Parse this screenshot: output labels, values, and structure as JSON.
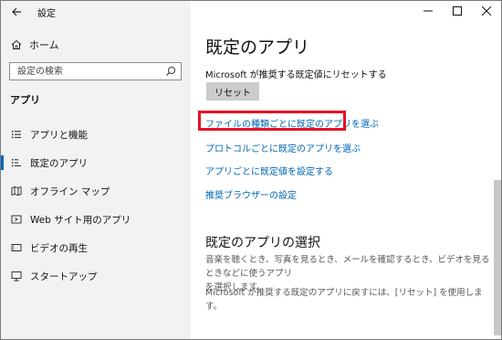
{
  "window": {
    "title": "設定"
  },
  "sidebar": {
    "home_label": "ホーム",
    "search_placeholder": "設定の検索",
    "section_label": "アプリ",
    "items": [
      {
        "label": "アプリと機能",
        "icon": "list-icon"
      },
      {
        "label": "既定のアプリ",
        "icon": "default-apps-icon",
        "selected": true
      },
      {
        "label": "オフライン マップ",
        "icon": "map-icon"
      },
      {
        "label": "Web サイト用のアプリ",
        "icon": "web-apps-icon"
      },
      {
        "label": "ビデオの再生",
        "icon": "video-icon"
      },
      {
        "label": "スタートアップ",
        "icon": "startup-icon"
      }
    ]
  },
  "main": {
    "title": "既定のアプリ",
    "reset_description": "Microsoft が推奨する既定値にリセットする",
    "reset_button": "リセット",
    "links": [
      "ファイルの種類ごとに既定のアプリを選ぶ",
      "プロトコルごとに既定のアプリを選ぶ",
      "アプリごとに既定値を設定する",
      "推奨ブラウザーの設定"
    ],
    "section_title": "既定のアプリの選択",
    "paragraph1_line1": "音楽を聴くとき、写真を見るとき、メールを確認するとき、ビデオを見るときなどに使うアプリ",
    "paragraph1_line2": "を選択します。",
    "paragraph2": "Microsoft が推奨する既定のアプリに戻すには、[リセット] を使用します。"
  },
  "colors": {
    "accent": "#0067c0",
    "link": "#0066b4",
    "highlight": "#e81123",
    "sidebar_bg": "#f2f2f2"
  }
}
